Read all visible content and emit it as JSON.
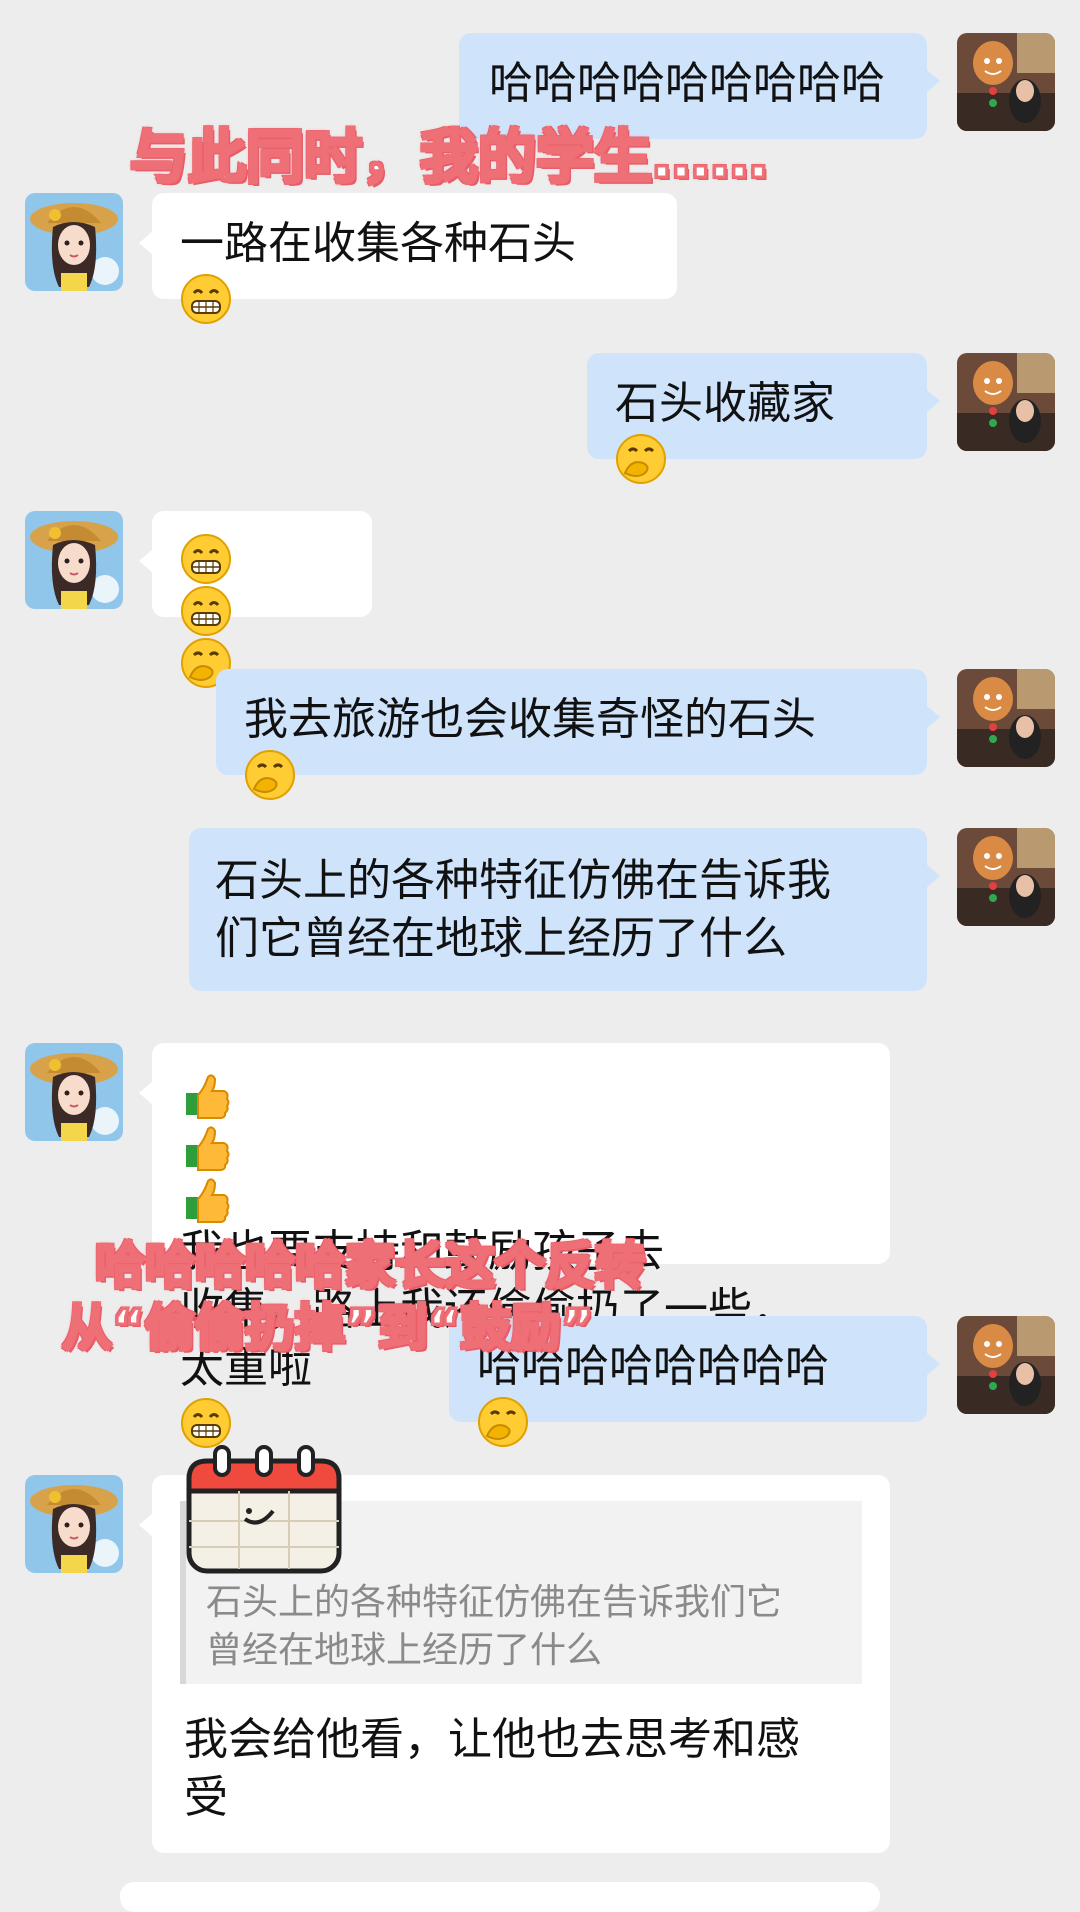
{
  "messages": [
    {
      "side": "me",
      "text": "哈哈哈哈哈哈哈哈哈"
    },
    {
      "side": "them",
      "text": "一路在收集各种石头",
      "emoji": "grin-emoji"
    },
    {
      "side": "me",
      "text": "石头收藏家",
      "emoji": "hand-over-mouth-emoji"
    },
    {
      "side": "them",
      "text": "",
      "emojis": [
        "grin-emoji",
        "grin-emoji",
        "hand-over-mouth-emoji"
      ]
    },
    {
      "side": "me",
      "text": "我去旅游也会收集奇怪的石头",
      "emoji": "hand-over-mouth-emoji"
    },
    {
      "side": "me",
      "lines": [
        "石头上的各种特征仿佛在告诉我",
        "们它曾经在地球上经历了什么"
      ]
    },
    {
      "side": "them",
      "line1": "我也要支持和鼓励孩子去",
      "line2": "收集，路上我还偷偷扔了一些，",
      "line3": "太重啦",
      "leading_emojis": [
        "thumbs-up-emoji",
        "thumbs-up-emoji",
        "thumbs-up-emoji"
      ],
      "emoji": "grin-emoji"
    },
    {
      "side": "me",
      "text": "哈哈哈哈哈哈哈哈",
      "emoji": "hand-over-mouth-emoji"
    },
    {
      "side": "them",
      "quote_lines": [
        "石头上的各种特征仿佛在告诉我们它",
        "曾经在地球上经历了什么"
      ],
      "lines": [
        "我会给他看，让他也去思考和感",
        "受"
      ]
    }
  ],
  "overlays": {
    "caption1": "与此同时，我的学生……",
    "caption2_line1": "哈哈哈哈哈家长这个反转",
    "caption2_line2": "从“偷偷扔掉”到“鼓励”"
  },
  "colors": {
    "my_bubble": "#cfe4fb",
    "their_bubble": "#ffffff",
    "background": "#ededed",
    "overlay_stroke": "#ef6f77"
  },
  "sticker": "calendar-sticker-icon"
}
